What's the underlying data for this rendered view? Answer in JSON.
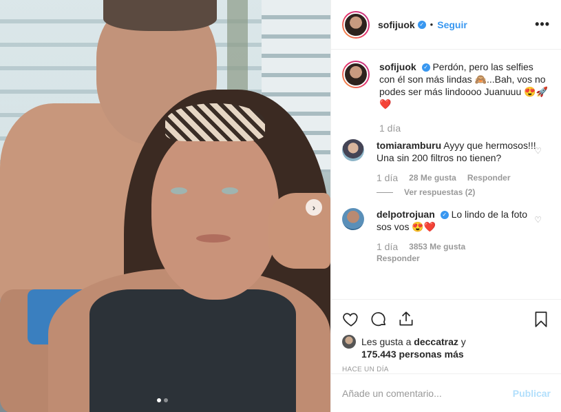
{
  "post": {
    "author": "sofijuok",
    "follow_label": "Seguir",
    "more_label": "•••",
    "separator": "•",
    "verified_mark": "✓",
    "next_arrow": "›",
    "carousel": {
      "count": 2,
      "active": 0
    }
  },
  "comments": [
    {
      "user": "sofijuok",
      "verified": true,
      "text": "Perdón, pero las selfies con él son más lindas 🙈...Bah, vos no podes ser más lindoooo Juanuuu 😍🚀 ❤️",
      "time": "1 día"
    },
    {
      "user": "tomiaramburu",
      "verified": false,
      "text": "Ayyy que hermosos!!! Una sin 200 filtros no tienen?",
      "time": "1 día",
      "likes": "28 Me gusta",
      "reply_label": "Responder",
      "view_replies": "Ver respuestas (2)"
    },
    {
      "user": "delpotrojuan",
      "verified": true,
      "text": "Lo lindo de la foto sos vos 😍❤️",
      "time": "1 día",
      "likes": "3853 Me gusta",
      "reply_label": "Responder"
    }
  ],
  "actions": {
    "liked_by_prefix": "Les gusta a",
    "liked_by_user": "deccatraz",
    "liked_by_suffix": "y",
    "others": "175.443 personas más",
    "timestamp": "HACE UN DÍA"
  },
  "composer": {
    "placeholder": "Añade un comentario...",
    "post_label": "Publicar"
  }
}
